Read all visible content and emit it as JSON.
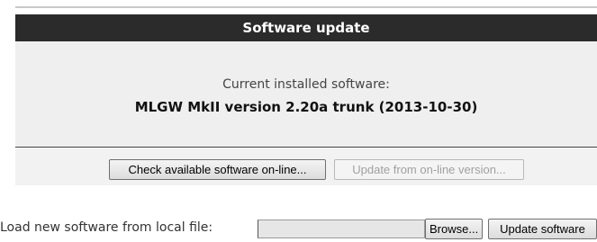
{
  "panel": {
    "title": "Software update",
    "current_label": "Current installed software:",
    "version": "MLGW MkII version 2.20a trunk (2013-10-30)"
  },
  "actions": {
    "check_online_label": "Check available software on-line...",
    "update_online_label": "Update from on-line version..."
  },
  "local_update": {
    "label": "Load new software from local file:",
    "file_value": "",
    "browse_label": "Browse...",
    "update_label": "Update software"
  }
}
